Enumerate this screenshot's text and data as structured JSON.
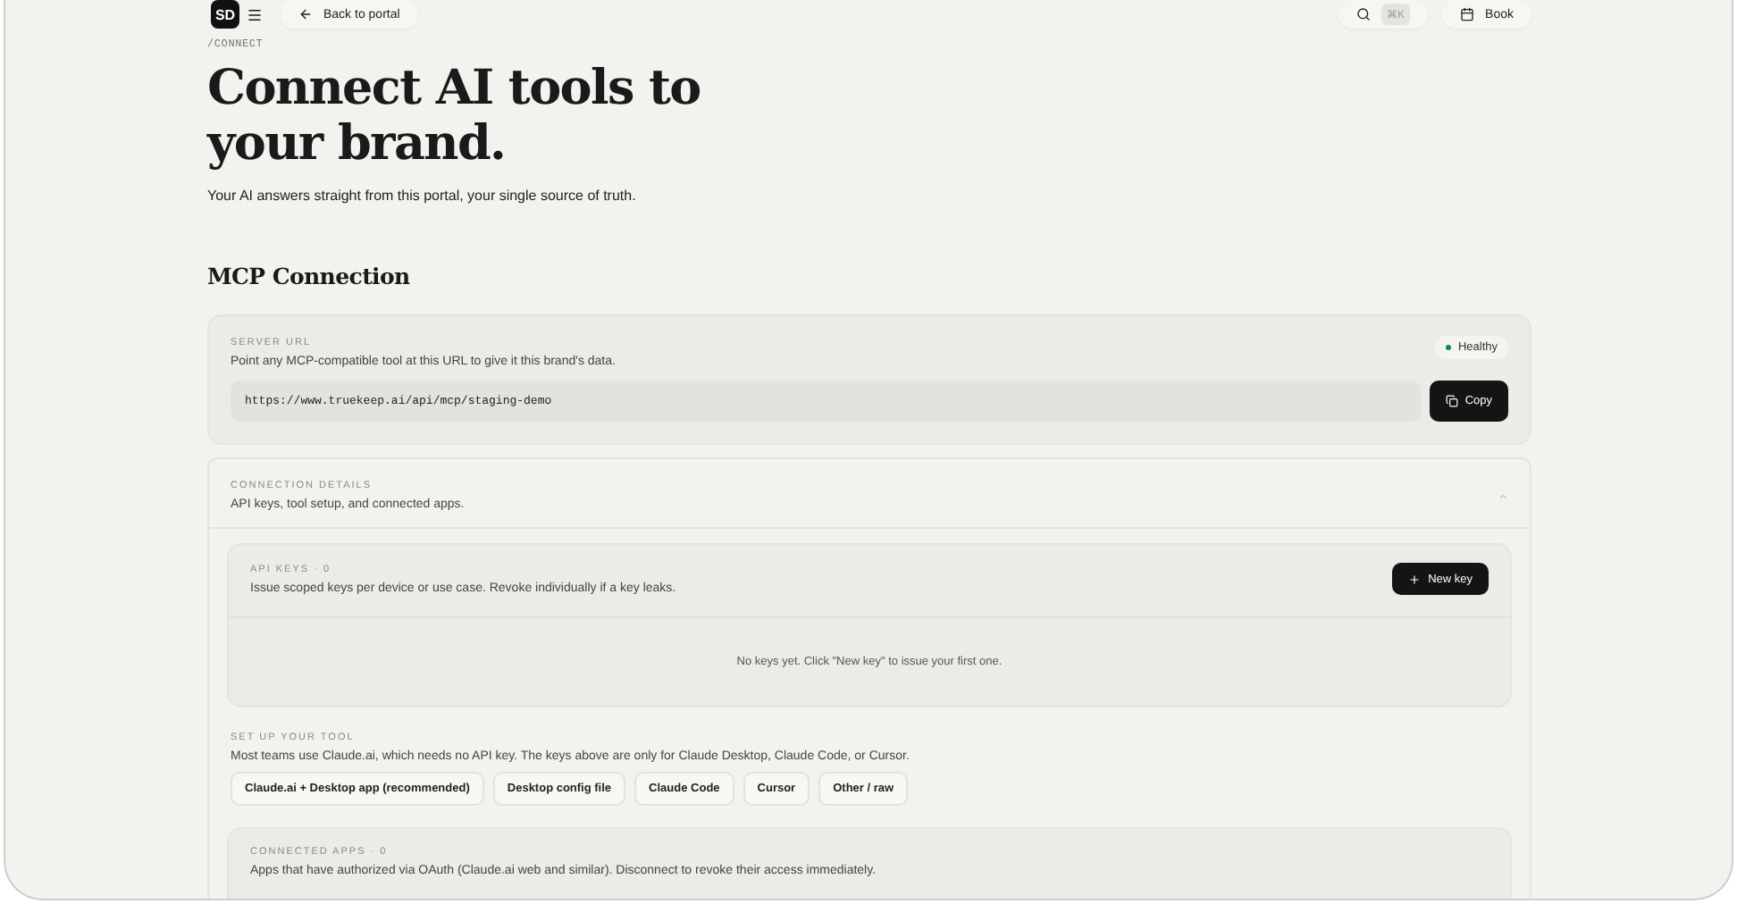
{
  "topbar": {
    "logo": "SD",
    "back": "Back to portal",
    "shortcut": "⌘K",
    "book": "Book"
  },
  "breadcrumb": "/CONNECT",
  "title": "Connect AI tools to your brand.",
  "subtitle": "Your AI answers straight from this portal, your single source of truth.",
  "section_title": "MCP Connection",
  "server": {
    "label": "SERVER URL",
    "description": "Point any MCP-compatible tool at this URL to give it this brand's data.",
    "status": "Healthy",
    "url": "https://www.truekeep.ai/api/mcp/staging-demo",
    "copy": "Copy"
  },
  "details": {
    "label": "CONNECTION DETAILS",
    "description": "API keys, tool setup, and connected apps.",
    "expanded": true,
    "api_keys": {
      "label": "API KEYS · 0",
      "description": "Issue scoped keys per device or use case. Revoke individually if a key leaks.",
      "new_key": "New key",
      "empty": "No keys yet. Click \"New key\" to issue your first one."
    },
    "setup": {
      "label": "SET UP YOUR TOOL",
      "description": "Most teams use Claude.ai, which needs no API key. The keys above are only for Claude Desktop, Claude Code, or Cursor.",
      "tools": [
        "Claude.ai + Desktop app (recommended)",
        "Desktop config file",
        "Claude Code",
        "Cursor",
        "Other / raw"
      ]
    },
    "connected_apps": {
      "label": "CONNECTED APPS · 0",
      "description": "Apps that have authorized via OAuth (Claude.ai web and similar). Disconnect to revoke their access immediately."
    }
  }
}
